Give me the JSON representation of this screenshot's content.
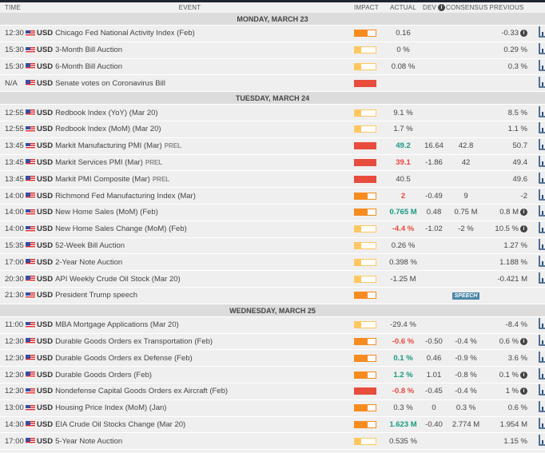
{
  "header": {
    "time": "TIME",
    "event": "EVENT",
    "impact": "IMPACT",
    "actual": "ACTUAL",
    "dev": "DEV",
    "consensus": "CONSENSUS",
    "previous": "PREVIOUS"
  },
  "colors": {
    "high": "#e74c3c",
    "medium": "#f68b1f",
    "low": "#fec760",
    "positive": "#169a80",
    "negative": "#e8473c"
  },
  "days": [
    {
      "label": "MONDAY, MARCH 23",
      "events": [
        {
          "time": "12:30",
          "currency": "USD",
          "event": "Chicago Fed National Activity Index (Feb)",
          "impact": "medium",
          "actual": "0.16",
          "previous": "-0.33",
          "prev_info": true
        },
        {
          "time": "15:30",
          "currency": "USD",
          "event": "3-Month Bill Auction",
          "impact": "low",
          "actual": "0 %",
          "previous": "0.29 %"
        },
        {
          "time": "15:30",
          "currency": "USD",
          "event": "6-Month Bill Auction",
          "impact": "low",
          "actual": "0.08 %",
          "previous": "0.3 %"
        },
        {
          "time": "N/A",
          "currency": "USD",
          "event": "Senate votes on Coronavirus Bill",
          "impact": "high"
        }
      ]
    },
    {
      "label": "TUESDAY, MARCH 24",
      "events": [
        {
          "time": "12:55",
          "currency": "USD",
          "event": "Redbook Index (YoY) (Mar 20)",
          "impact": "low",
          "actual": "9.1 %",
          "previous": "8.5 %"
        },
        {
          "time": "12:55",
          "currency": "USD",
          "event": "Redbook Index (MoM) (Mar 20)",
          "impact": "low",
          "actual": "1.7 %",
          "previous": "1.1 %"
        },
        {
          "time": "13:45",
          "currency": "USD",
          "event": "Markit Manufacturing PMI (Mar)",
          "tag": "PREL",
          "impact": "high",
          "actual": "49.2",
          "actual_tone": "green",
          "dev": "16.64",
          "consensus": "42.8",
          "previous": "50.7"
        },
        {
          "time": "13:45",
          "currency": "USD",
          "event": "Markit Services PMI (Mar)",
          "tag": "PREL",
          "impact": "high",
          "actual": "39.1",
          "actual_tone": "red",
          "dev": "-1.86",
          "consensus": "42",
          "previous": "49.4"
        },
        {
          "time": "13:45",
          "currency": "USD",
          "event": "Markit PMI Composite (Mar)",
          "tag": "PREL",
          "impact": "high",
          "actual": "40.5",
          "previous": "49.6"
        },
        {
          "time": "14:00",
          "currency": "USD",
          "event": "Richmond Fed Manufacturing Index (Mar)",
          "impact": "medium",
          "actual": "2",
          "actual_tone": "red",
          "dev": "-0.49",
          "consensus": "9",
          "previous": "-2"
        },
        {
          "time": "14:00",
          "currency": "USD",
          "event": "New Home Sales (MoM) (Feb)",
          "impact": "medium",
          "actual": "0.765 M",
          "actual_tone": "green",
          "dev": "0.48",
          "consensus": "0.75 M",
          "previous": "0.8 M",
          "prev_info": true
        },
        {
          "time": "14:00",
          "currency": "USD",
          "event": "New Home Sales Change (MoM) (Feb)",
          "impact": "low",
          "actual": "-4.4 %",
          "actual_tone": "red",
          "dev": "-1.02",
          "consensus": "-2 %",
          "previous": "10.5 %",
          "prev_info": true
        },
        {
          "time": "15:35",
          "currency": "USD",
          "event": "52-Week Bill Auction",
          "impact": "low",
          "actual": "0.26 %",
          "previous": "1.27 %"
        },
        {
          "time": "17:00",
          "currency": "USD",
          "event": "2-Year Note Auction",
          "impact": "low",
          "actual": "0.398 %",
          "previous": "1.188 %"
        },
        {
          "time": "20:30",
          "currency": "USD",
          "event": "API Weekly Crude Oil Stock (Mar 20)",
          "impact": "low",
          "actual": "-1.25 M",
          "previous": "-0.421 M"
        },
        {
          "time": "21:30",
          "currency": "USD",
          "event": "President Trump speech",
          "impact": "medium",
          "badge": "SPEECH",
          "no_chart": true
        }
      ]
    },
    {
      "label": "WEDNESDAY, MARCH 25",
      "events": [
        {
          "time": "11:00",
          "currency": "USD",
          "event": "MBA Mortgage Applications (Mar 20)",
          "impact": "low",
          "actual": "-29.4 %",
          "previous": "-8.4 %"
        },
        {
          "time": "12:30",
          "currency": "USD",
          "event": "Durable Goods Orders ex Transportation (Feb)",
          "impact": "medium",
          "actual": "-0.6 %",
          "actual_tone": "red",
          "dev": "-0.50",
          "consensus": "-0.4 %",
          "previous": "0.6 %",
          "prev_info": true
        },
        {
          "time": "12:30",
          "currency": "USD",
          "event": "Durable Goods Orders ex Defense (Feb)",
          "impact": "medium",
          "actual": "0.1 %",
          "actual_tone": "green",
          "dev": "0.46",
          "consensus": "-0.9 %",
          "previous": "3.6 %"
        },
        {
          "time": "12:30",
          "currency": "USD",
          "event": "Durable Goods Orders (Feb)",
          "impact": "medium",
          "actual": "1.2 %",
          "actual_tone": "green",
          "dev": "1.01",
          "consensus": "-0.8 %",
          "previous": "0.1 %",
          "prev_info": true
        },
        {
          "time": "12:30",
          "currency": "USD",
          "event": "Nondefense Capital Goods Orders ex Aircraft (Feb)",
          "impact": "high",
          "actual": "-0.8 %",
          "actual_tone": "red",
          "dev": "-0.45",
          "consensus": "-0.4 %",
          "previous": "1 %",
          "prev_info": true
        },
        {
          "time": "13:00",
          "currency": "USD",
          "event": "Housing Price Index (MoM) (Jan)",
          "impact": "medium",
          "actual": "0.3 %",
          "dev": "0",
          "consensus": "0.3 %",
          "previous": "0.6 %"
        },
        {
          "time": "14:30",
          "currency": "USD",
          "event": "EIA Crude Oil Stocks Change (Mar 20)",
          "impact": "medium",
          "actual": "1.623 M",
          "actual_tone": "green",
          "dev": "-0.40",
          "consensus": "2.774 M",
          "previous": "1.954 M"
        },
        {
          "time": "17:00",
          "currency": "USD",
          "event": "5-Year Note Auction",
          "impact": "low",
          "actual": "0.535 %",
          "previous": "1.15 %"
        }
      ]
    }
  ]
}
